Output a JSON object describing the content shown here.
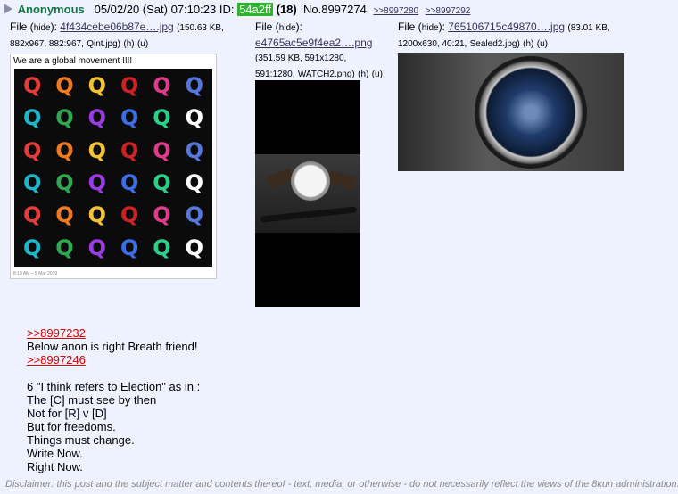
{
  "post": {
    "name": "Anonymous",
    "date": "05/02/20 (Sat) 07:10:23",
    "id_label": "ID:",
    "id": "54a2ff",
    "count": "(18)",
    "number": "No.8997274",
    "backlinks": [
      ">>8997280",
      ">>8997292"
    ]
  },
  "files": [
    {
      "label": "File",
      "hide": "hide",
      "filename": "4f434cebe06b87e….jpg",
      "info1": "(150.63 KB,",
      "info2": "882x967, 882:967,",
      "orig": "Qint.jpg",
      "h": "(h)",
      "u": "(u)"
    },
    {
      "label": "File",
      "hide": "hide",
      "filename": "e4765ac5e9f4ea2….png",
      "info1": "(351.59 KB, 591x1280,",
      "info2": "591:1280,",
      "orig": "WATCH2.png",
      "h": "(h)",
      "u": "(u)"
    },
    {
      "label": "File",
      "hide": "hide",
      "filename": "765106715c49870….jpg",
      "info1": "(83.01 KB,",
      "info2": "1200x630, 40:21,",
      "orig": "Sealed2.jpg",
      "h": "(h)",
      "u": "(u)"
    }
  ],
  "qimage": {
    "caption": "We are a global movement !!!!",
    "letter": "Q",
    "timestamp": "8:19 AM – 9 Mar 2019"
  },
  "body_lines": [
    {
      "type": "quote",
      "text": ">>8997232"
    },
    {
      "type": "text",
      "text": "Below anon is right Breath friend!"
    },
    {
      "type": "quote",
      "text": ">>8997246"
    },
    {
      "type": "blank",
      "text": ""
    },
    {
      "type": "text",
      "text": "6 \"I think refers to Election\" as in :"
    },
    {
      "type": "text",
      "text": "The [C] must see by then"
    },
    {
      "type": "text",
      "text": "Not for [R] v [D]"
    },
    {
      "type": "text",
      "text": "But for freedoms."
    },
    {
      "type": "text",
      "text": "Things must change."
    },
    {
      "type": "text",
      "text": "Write Now."
    },
    {
      "type": "text",
      "text": "Right Now."
    }
  ],
  "disclaimer": "Disclaimer: this post and the subject matter and contents thereof - text, media, or otherwise - do not necessarily reflect the views of the 8kun administration.",
  "colors": {
    "background": "#eef2ff",
    "name": "#117743",
    "id_bg": "#2db62d",
    "link": "#34345c",
    "quote": "#dd0000"
  }
}
